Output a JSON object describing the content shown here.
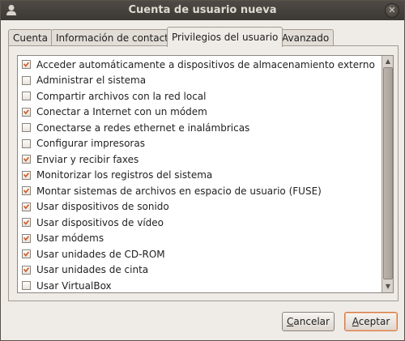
{
  "window": {
    "title": "Cuenta de usuario nueva",
    "close_glyph": "✕"
  },
  "tabs": [
    {
      "label": "Cuenta",
      "active": false
    },
    {
      "label": "Información de contacto",
      "active": false
    },
    {
      "label": "Privilegios del usuario",
      "active": true
    },
    {
      "label": "Avanzado",
      "active": false
    }
  ],
  "privileges": [
    {
      "label": "Acceder automáticamente a dispositivos de almacenamiento externo",
      "checked": true
    },
    {
      "label": "Administrar el sistema",
      "checked": false
    },
    {
      "label": "Compartir archivos con la red local",
      "checked": false
    },
    {
      "label": "Conectar a Internet con un módem",
      "checked": true
    },
    {
      "label": "Conectarse a redes ethernet e inalámbricas",
      "checked": false
    },
    {
      "label": "Configurar impresoras",
      "checked": false
    },
    {
      "label": "Enviar y recibir faxes",
      "checked": true
    },
    {
      "label": "Monitorizar los registros del sistema",
      "checked": true
    },
    {
      "label": "Montar sistemas de archivos en espacio de usuario (FUSE)",
      "checked": true
    },
    {
      "label": "Usar dispositivos de sonido",
      "checked": true
    },
    {
      "label": "Usar dispositivos de vídeo",
      "checked": true
    },
    {
      "label": "Usar módems",
      "checked": true
    },
    {
      "label": "Usar unidades de CD-ROM",
      "checked": true
    },
    {
      "label": "Usar unidades de cinta",
      "checked": true
    },
    {
      "label": "Usar VirtualBox",
      "checked": false
    }
  ],
  "buttons": {
    "cancel": {
      "mnemonic": "C",
      "rest": "ancelar"
    },
    "accept": {
      "mnemonic": "A",
      "rest": "ceptar"
    }
  },
  "colors": {
    "check_accent": "#cf5a23",
    "titlebar": "#3c3834",
    "default_button_border": "#d27b4a"
  }
}
